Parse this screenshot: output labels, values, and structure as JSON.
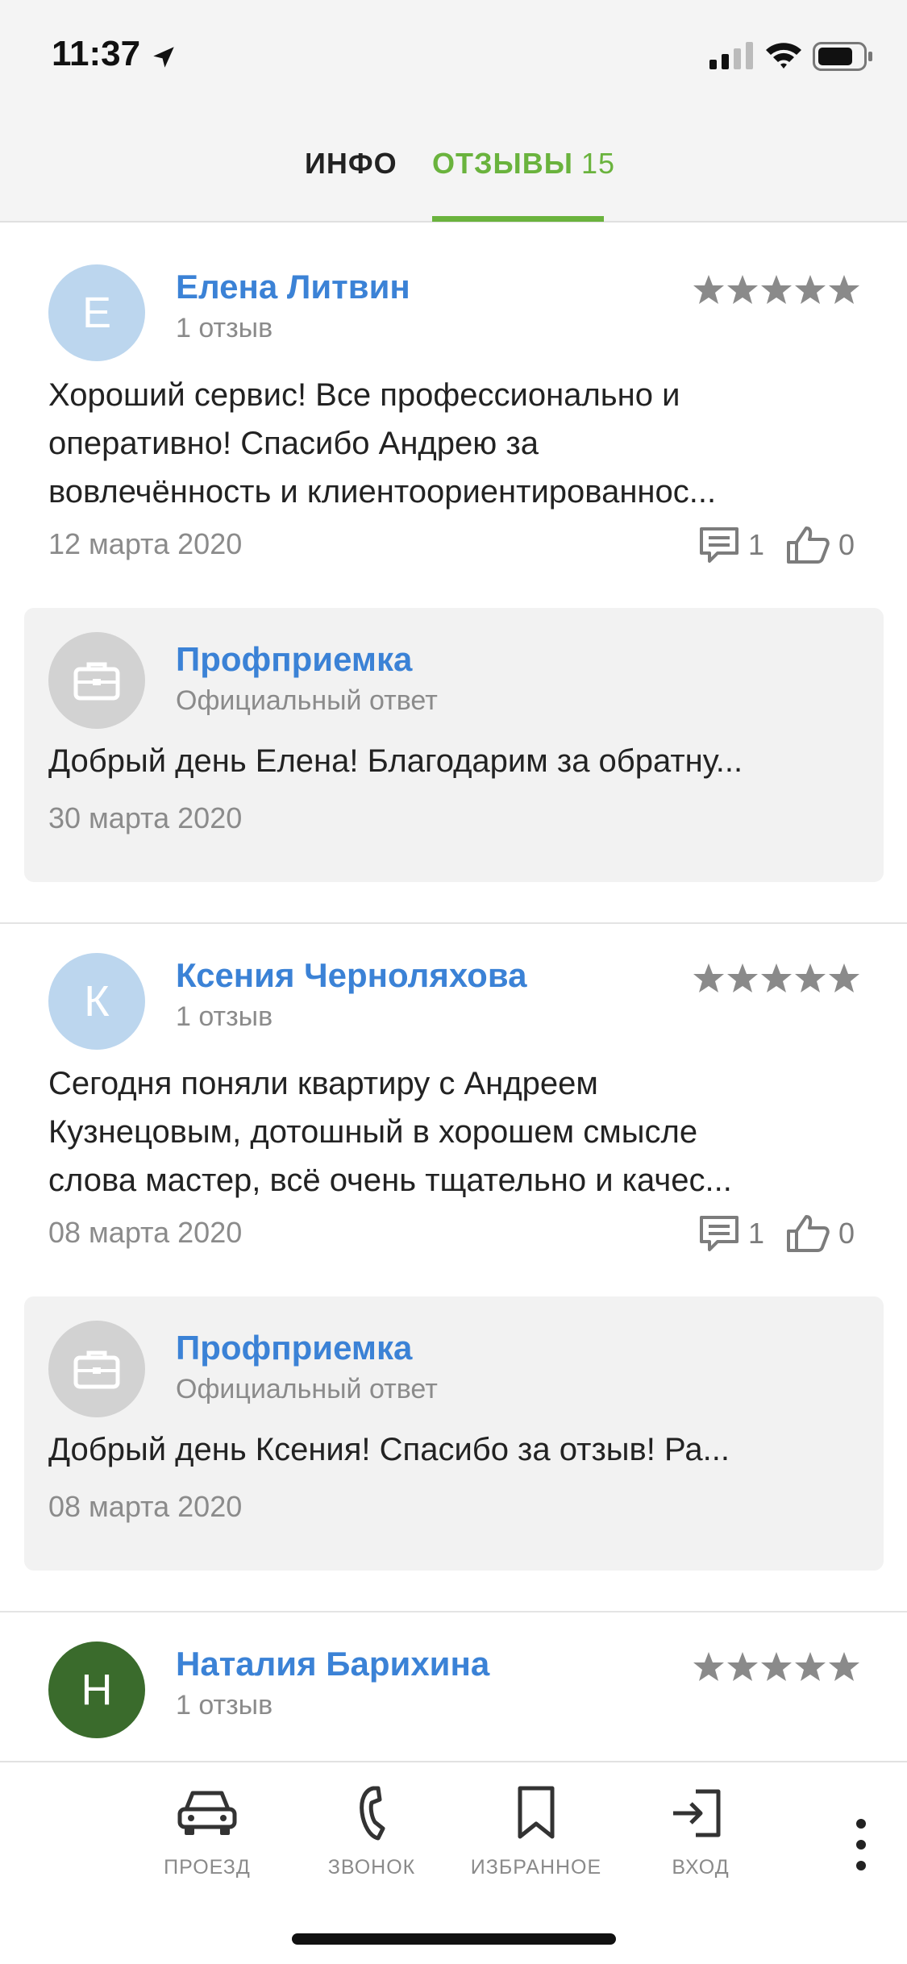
{
  "status_bar": {
    "time": "11:37"
  },
  "tabs": {
    "info": "ИНФО",
    "reviews": "ОТЗЫВЫ",
    "reviews_count": "15",
    "active": "reviews"
  },
  "colors": {
    "accent": "#6ab33d",
    "link": "#3b82d6",
    "muted": "#8b8b8b"
  },
  "reviews": [
    {
      "initial": "Е",
      "author": "Елена Литвин",
      "count": "1 отзыв",
      "rating": 5,
      "lines": [
        "Хороший сервис! Все профессионально и",
        "оперативно! Спасибо Андрею за",
        "вовлечённость и клиентоориентированнос..."
      ],
      "date": "12 марта 2020",
      "comments": "1",
      "likes": "0",
      "reply": {
        "author": "Профприемка",
        "subtitle": "Официальный ответ",
        "text": "Добрый день Елена! Благодарим за обратну...",
        "date": "30 марта 2020"
      }
    },
    {
      "initial": "К",
      "author": "Ксения Черноляхова",
      "count": "1 отзыв",
      "rating": 5,
      "lines": [
        "Сегодня поняли квартиру с Андреем",
        "Кузнецовым, дотошный в хорошем смысле",
        "слова мастер, всё очень тщательно и качес..."
      ],
      "date": "08 марта 2020",
      "comments": "1",
      "likes": "0",
      "reply": {
        "author": "Профприемка",
        "subtitle": "Официальный ответ",
        "text": "Добрый день Ксения! Спасибо за отзыв! Ра...",
        "date": "08 марта 2020"
      }
    },
    {
      "initial": "Н",
      "author": "Наталия Барихина",
      "count": "1 отзыв",
      "rating": 5
    }
  ],
  "bottom_nav": [
    {
      "label": "ПРОЕЗД",
      "icon": "car-icon"
    },
    {
      "label": "ЗВОНОК",
      "icon": "phone-icon"
    },
    {
      "label": "ИЗБРАННОЕ",
      "icon": "bookmark-icon"
    },
    {
      "label": "ВХОД",
      "icon": "login-icon"
    }
  ]
}
